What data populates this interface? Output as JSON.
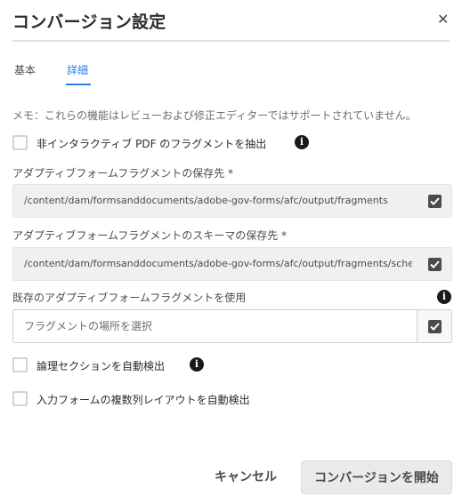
{
  "dialog": {
    "title": "コンバージョン設定",
    "close_icon": "close-icon"
  },
  "tabs": [
    {
      "label": "基本",
      "active": false
    },
    {
      "label": "詳細",
      "active": true
    }
  ],
  "note": "メモ：これらの機能はレビューおよび修正エディターではサポートされていません。",
  "extract_fragments": {
    "label": "非インタラクティブ PDF のフラグメントを抽出",
    "checked": false
  },
  "fragment_save_path": {
    "label": "アダプティブフォームフラグメントの保存先 *",
    "value": "/content/dam/formsanddocuments/adobe-gov-forms/afc/output/fragments"
  },
  "fragment_schema_save_path": {
    "label": "アダプティブフォームフラグメントのスキーマの保存先 *",
    "value": "/content/dam/formsanddocuments/adobe-gov-forms/afc/output/fragments/schema"
  },
  "existing_fragments": {
    "label": "既存のアダプティブフォームフラグメントを使用",
    "placeholder": "フラグメントの場所を選択"
  },
  "auto_detect_logical_sections": {
    "label": "論理セクションを自動検出",
    "checked": false
  },
  "auto_detect_multicolumn": {
    "label": "入力フォームの複数列レイアウトを自動検出",
    "checked": false
  },
  "footer": {
    "cancel_label": "キャンセル",
    "start_label": "コンバージョンを開始"
  },
  "colors": {
    "accent": "#2680eb",
    "text": "#2c2c2c",
    "muted": "#6e6e6e",
    "checkbox_fill": "#4b4b4b"
  }
}
